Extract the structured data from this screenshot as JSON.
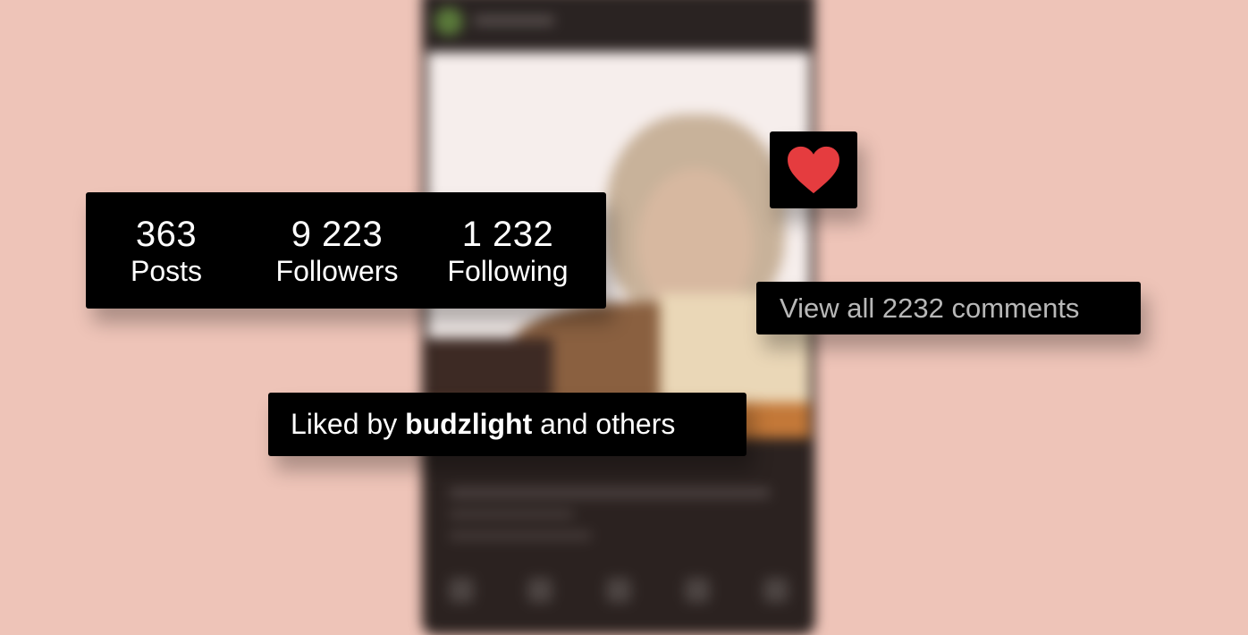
{
  "profile_stats": [
    {
      "value": "363",
      "label": "Posts"
    },
    {
      "value": "9 223",
      "label": "Followers"
    },
    {
      "value": "1 232",
      "label": "Following"
    }
  ],
  "like": {
    "icon": "heart-icon",
    "color": "#e53c3f"
  },
  "comments": {
    "link_text": "View all 2232 comments"
  },
  "liked_by": {
    "prefix": "Liked by",
    "user": "budzlight",
    "suffix": "and others"
  },
  "colors": {
    "background": "#eec4b8",
    "card": "#000000",
    "heart": "#e53c3f"
  }
}
